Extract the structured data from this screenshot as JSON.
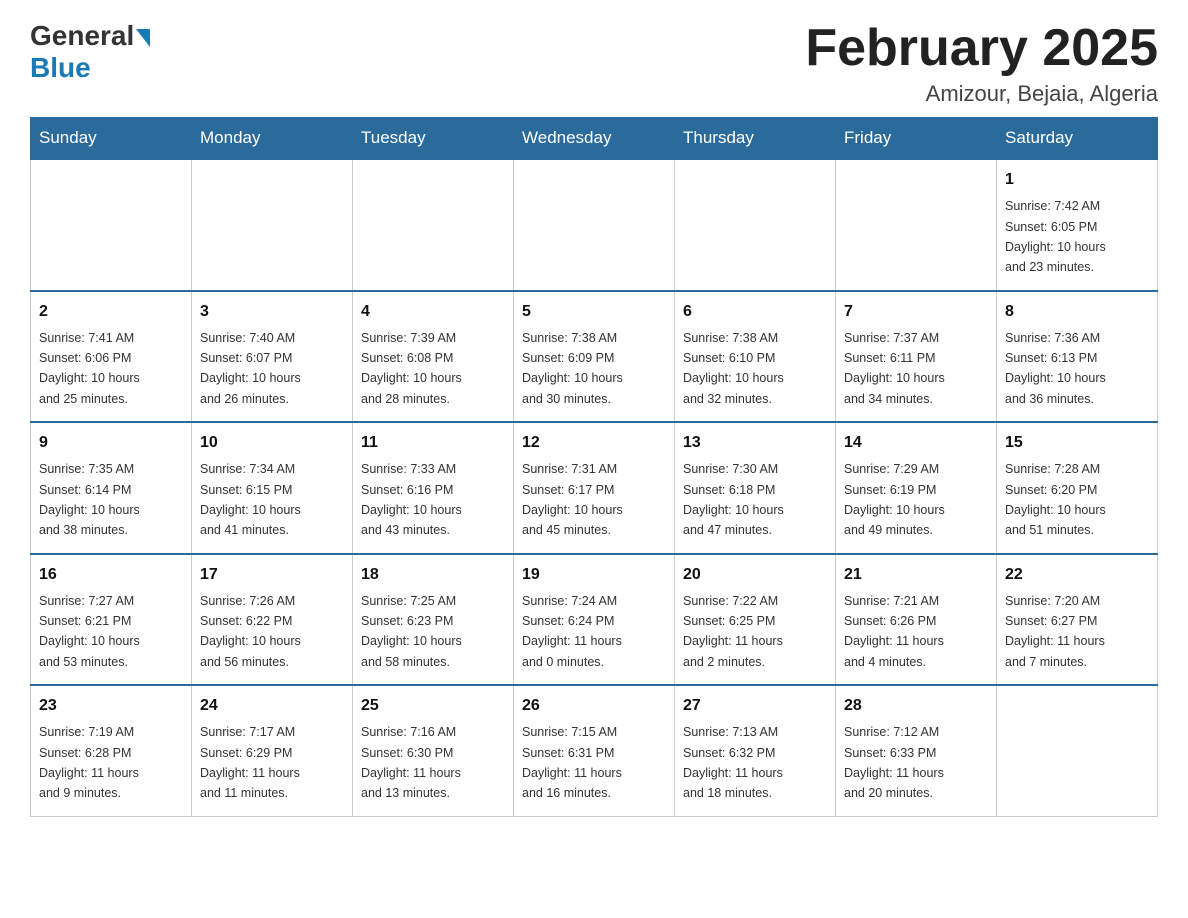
{
  "header": {
    "logo_general": "General",
    "logo_blue": "Blue",
    "month_title": "February 2025",
    "location": "Amizour, Bejaia, Algeria"
  },
  "weekdays": [
    "Sunday",
    "Monday",
    "Tuesday",
    "Wednesday",
    "Thursday",
    "Friday",
    "Saturday"
  ],
  "weeks": [
    [
      {
        "day": "",
        "info": ""
      },
      {
        "day": "",
        "info": ""
      },
      {
        "day": "",
        "info": ""
      },
      {
        "day": "",
        "info": ""
      },
      {
        "day": "",
        "info": ""
      },
      {
        "day": "",
        "info": ""
      },
      {
        "day": "1",
        "info": "Sunrise: 7:42 AM\nSunset: 6:05 PM\nDaylight: 10 hours\nand 23 minutes."
      }
    ],
    [
      {
        "day": "2",
        "info": "Sunrise: 7:41 AM\nSunset: 6:06 PM\nDaylight: 10 hours\nand 25 minutes."
      },
      {
        "day": "3",
        "info": "Sunrise: 7:40 AM\nSunset: 6:07 PM\nDaylight: 10 hours\nand 26 minutes."
      },
      {
        "day": "4",
        "info": "Sunrise: 7:39 AM\nSunset: 6:08 PM\nDaylight: 10 hours\nand 28 minutes."
      },
      {
        "day": "5",
        "info": "Sunrise: 7:38 AM\nSunset: 6:09 PM\nDaylight: 10 hours\nand 30 minutes."
      },
      {
        "day": "6",
        "info": "Sunrise: 7:38 AM\nSunset: 6:10 PM\nDaylight: 10 hours\nand 32 minutes."
      },
      {
        "day": "7",
        "info": "Sunrise: 7:37 AM\nSunset: 6:11 PM\nDaylight: 10 hours\nand 34 minutes."
      },
      {
        "day": "8",
        "info": "Sunrise: 7:36 AM\nSunset: 6:13 PM\nDaylight: 10 hours\nand 36 minutes."
      }
    ],
    [
      {
        "day": "9",
        "info": "Sunrise: 7:35 AM\nSunset: 6:14 PM\nDaylight: 10 hours\nand 38 minutes."
      },
      {
        "day": "10",
        "info": "Sunrise: 7:34 AM\nSunset: 6:15 PM\nDaylight: 10 hours\nand 41 minutes."
      },
      {
        "day": "11",
        "info": "Sunrise: 7:33 AM\nSunset: 6:16 PM\nDaylight: 10 hours\nand 43 minutes."
      },
      {
        "day": "12",
        "info": "Sunrise: 7:31 AM\nSunset: 6:17 PM\nDaylight: 10 hours\nand 45 minutes."
      },
      {
        "day": "13",
        "info": "Sunrise: 7:30 AM\nSunset: 6:18 PM\nDaylight: 10 hours\nand 47 minutes."
      },
      {
        "day": "14",
        "info": "Sunrise: 7:29 AM\nSunset: 6:19 PM\nDaylight: 10 hours\nand 49 minutes."
      },
      {
        "day": "15",
        "info": "Sunrise: 7:28 AM\nSunset: 6:20 PM\nDaylight: 10 hours\nand 51 minutes."
      }
    ],
    [
      {
        "day": "16",
        "info": "Sunrise: 7:27 AM\nSunset: 6:21 PM\nDaylight: 10 hours\nand 53 minutes."
      },
      {
        "day": "17",
        "info": "Sunrise: 7:26 AM\nSunset: 6:22 PM\nDaylight: 10 hours\nand 56 minutes."
      },
      {
        "day": "18",
        "info": "Sunrise: 7:25 AM\nSunset: 6:23 PM\nDaylight: 10 hours\nand 58 minutes."
      },
      {
        "day": "19",
        "info": "Sunrise: 7:24 AM\nSunset: 6:24 PM\nDaylight: 11 hours\nand 0 minutes."
      },
      {
        "day": "20",
        "info": "Sunrise: 7:22 AM\nSunset: 6:25 PM\nDaylight: 11 hours\nand 2 minutes."
      },
      {
        "day": "21",
        "info": "Sunrise: 7:21 AM\nSunset: 6:26 PM\nDaylight: 11 hours\nand 4 minutes."
      },
      {
        "day": "22",
        "info": "Sunrise: 7:20 AM\nSunset: 6:27 PM\nDaylight: 11 hours\nand 7 minutes."
      }
    ],
    [
      {
        "day": "23",
        "info": "Sunrise: 7:19 AM\nSunset: 6:28 PM\nDaylight: 11 hours\nand 9 minutes."
      },
      {
        "day": "24",
        "info": "Sunrise: 7:17 AM\nSunset: 6:29 PM\nDaylight: 11 hours\nand 11 minutes."
      },
      {
        "day": "25",
        "info": "Sunrise: 7:16 AM\nSunset: 6:30 PM\nDaylight: 11 hours\nand 13 minutes."
      },
      {
        "day": "26",
        "info": "Sunrise: 7:15 AM\nSunset: 6:31 PM\nDaylight: 11 hours\nand 16 minutes."
      },
      {
        "day": "27",
        "info": "Sunrise: 7:13 AM\nSunset: 6:32 PM\nDaylight: 11 hours\nand 18 minutes."
      },
      {
        "day": "28",
        "info": "Sunrise: 7:12 AM\nSunset: 6:33 PM\nDaylight: 11 hours\nand 20 minutes."
      },
      {
        "day": "",
        "info": ""
      }
    ]
  ]
}
